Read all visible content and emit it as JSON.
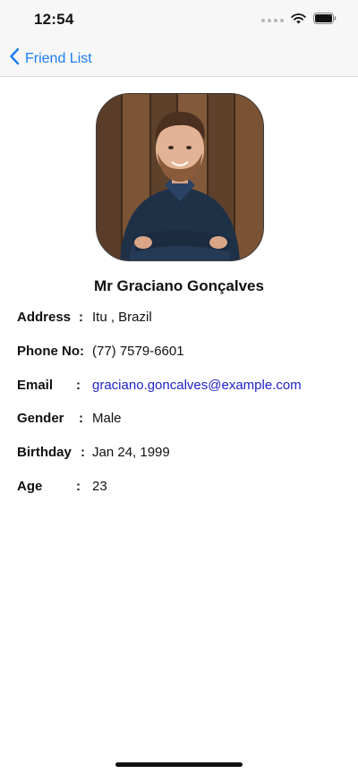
{
  "status_bar": {
    "time": "12:54",
    "icons": [
      "cellular-dots-icon",
      "wifi-icon",
      "battery-icon"
    ]
  },
  "nav": {
    "back_label": "Friend List",
    "back_icon": "chevron-left-icon",
    "accent_color": "#1a7cf2"
  },
  "profile": {
    "name": "Mr Graciano Gonçalves",
    "photo": "profile-photo-man-crossed-arms",
    "details": [
      {
        "label": "Address",
        "colon": ":",
        "value": "Itu , Brazil"
      },
      {
        "label": "Phone No:",
        "colon": "",
        "value": "(77) 7579-6601"
      },
      {
        "label": "Email",
        "colon": ":",
        "value": "graciano.goncalves@example.com",
        "link_color": "#2222cc"
      },
      {
        "label": "Gender",
        "colon": ":",
        "value": "Male"
      },
      {
        "label": "Birthday",
        "colon": ":",
        "value": "Jan 24, 1999"
      },
      {
        "label": "Age",
        "colon": ":",
        "value": "23"
      }
    ]
  }
}
